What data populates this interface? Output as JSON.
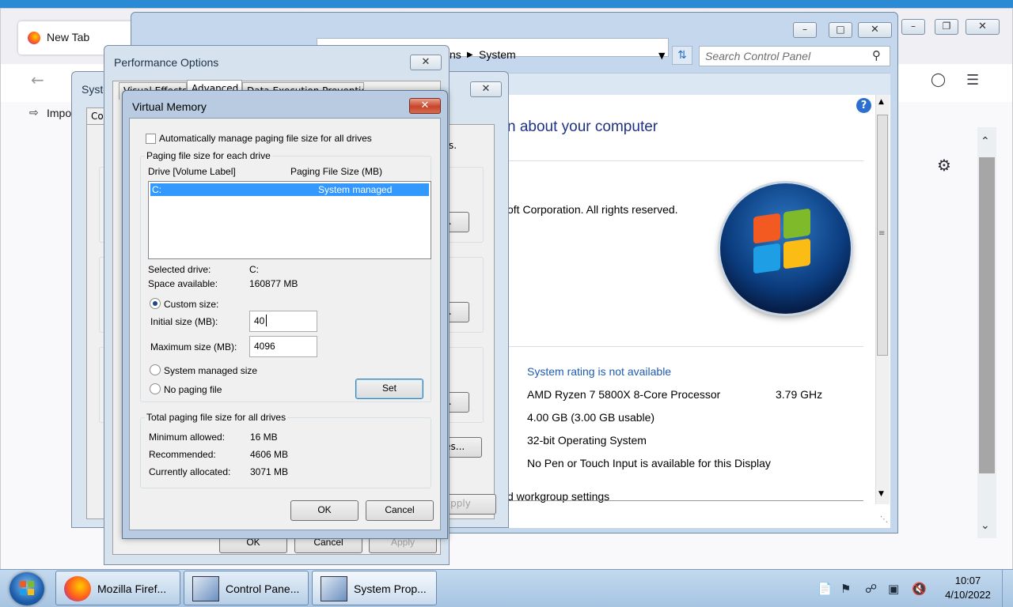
{
  "firefox": {
    "tab_title": "New Tab",
    "import_text": "Impo",
    "taskbar_label": "Mozilla Firef..."
  },
  "control_panel": {
    "breadcrumb_prev": "ns",
    "breadcrumb_current": "System",
    "search_placeholder": "Search Control Panel",
    "heading": "n about your computer",
    "copyright": "oft Corporation.  All rights reserved.",
    "rating": "System rating is not available",
    "processor": "AMD Ryzen 7 5800X 8-Core Processor",
    "processor_speed": "3.79 GHz",
    "memory": "4.00 GB (3.00 GB usable)",
    "system_type": "32-bit Operating System",
    "pen_touch": "No Pen or Touch Input is available for this Display",
    "workgroup": "d workgroup settings",
    "taskbar_label": "Control Pane..."
  },
  "system_properties": {
    "title": "Syste",
    "tab_partial": "Co",
    "partial_text": "s.",
    "btn1": "...",
    "btn2": "...",
    "btn3": "...",
    "env_btn": "les...",
    "ok": "OK",
    "cancel": "Cancel",
    "apply": "Apply",
    "apply_partial": "pply",
    "taskbar_label": "System Prop..."
  },
  "performance_options": {
    "title": "Performance Options",
    "tabs": [
      "Visual Effects",
      "Advanced",
      "Data Execution Prevention"
    ]
  },
  "virtual_memory": {
    "title": "Virtual Memory",
    "auto_manage_label": "Automatically manage paging file size for all drives",
    "auto_manage_checked": false,
    "group_paging": "Paging file size for each drive",
    "col_drive": "Drive  [Volume Label]",
    "col_size": "Paging File Size (MB)",
    "drives": [
      {
        "drive": "C:",
        "size": "System managed"
      }
    ],
    "selected_drive_label": "Selected drive:",
    "selected_drive_value": "C:",
    "space_label": "Space available:",
    "space_value": "160877 MB",
    "custom_size_label": "Custom size:",
    "initial_size_label": "Initial size (MB):",
    "initial_size_value": "40",
    "max_size_label": "Maximum size (MB):",
    "max_size_value": "4096",
    "system_managed_label": "System managed size",
    "no_paging_label": "No paging file",
    "set_button": "Set",
    "group_total": "Total paging file size for all drives",
    "min_allowed_label": "Minimum allowed:",
    "min_allowed_value": "16 MB",
    "recommended_label": "Recommended:",
    "recommended_value": "4606 MB",
    "allocated_label": "Currently allocated:",
    "allocated_value": "3071 MB",
    "ok": "OK",
    "cancel": "Cancel",
    "selected_radio": "custom"
  },
  "taskbar": {
    "time": "10:07",
    "date": "4/10/2022"
  },
  "colors": {
    "selection": "#3399ff",
    "link": "#1e5cb0",
    "heading": "#1e3287",
    "close_red": "#c7442a"
  }
}
